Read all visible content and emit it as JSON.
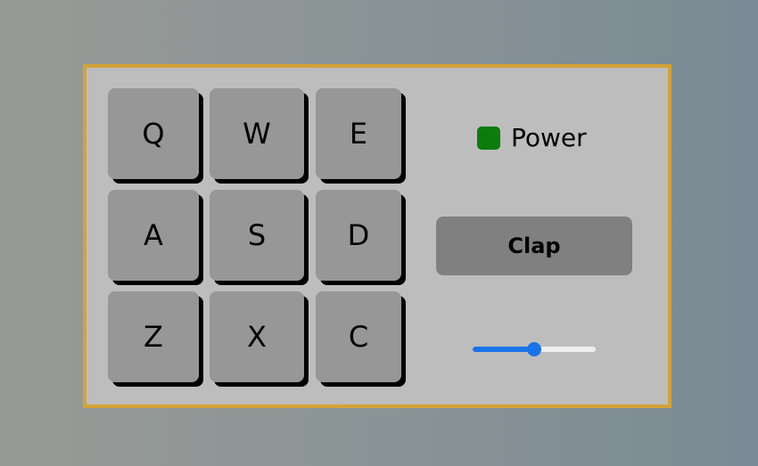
{
  "pads": [
    {
      "key": "Q"
    },
    {
      "key": "W"
    },
    {
      "key": "E"
    },
    {
      "key": "A"
    },
    {
      "key": "S"
    },
    {
      "key": "D"
    },
    {
      "key": "Z"
    },
    {
      "key": "X"
    },
    {
      "key": "C"
    }
  ],
  "power": {
    "label": "Power",
    "on": true,
    "led_color": "#0a7d0a"
  },
  "display": {
    "text": "Clap"
  },
  "volume": {
    "value": 0.5
  },
  "colors": {
    "frame_border": "#d4a334",
    "panel": "#bdbdbd",
    "pad": "#979797",
    "display": "#808080",
    "slider_accent": "#1a73e8"
  }
}
